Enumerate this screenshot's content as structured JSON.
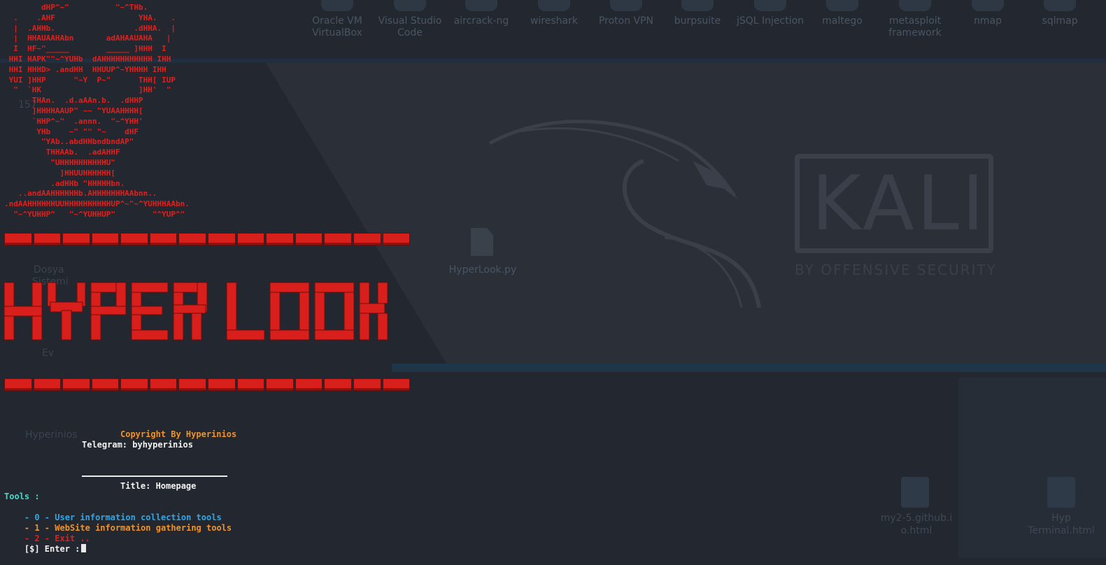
{
  "desktop": {
    "top_icons": [
      {
        "label": "Oracle VM VirtualBox",
        "line1": "Oracle VM",
        "line2": "VirtualBox"
      },
      {
        "label": "Visual Studio Code",
        "line1": "Visual Studio",
        "line2": "Code"
      },
      {
        "label": "aircrack-ng",
        "line1": "aircrack-ng",
        "line2": ""
      },
      {
        "label": "wireshark",
        "line1": "wireshark",
        "line2": ""
      },
      {
        "label": "Proton VPN",
        "line1": "Proton VPN",
        "line2": ""
      },
      {
        "label": "burpsuite",
        "line1": "burpsuite",
        "line2": ""
      },
      {
        "label": "jSQL Injection",
        "line1": "jSQL Injection",
        "line2": ""
      },
      {
        "label": "maltego",
        "line1": "maltego",
        "line2": ""
      },
      {
        "label": "metasploit framework",
        "line1": "metasploit",
        "line2": "framework"
      },
      {
        "label": "nmap",
        "line1": "nmap",
        "line2": ""
      },
      {
        "label": "sqlmap",
        "line1": "sqlmap",
        "line2": ""
      }
    ],
    "file_icon_label": "HyperLook.py",
    "bottom_right_icons": [
      {
        "line1": "my2-5.github.i",
        "line2": "o.html"
      },
      {
        "line1": "Hyp",
        "line2": "Terminal.html"
      }
    ],
    "left_ghost_labels": [
      "157",
      "Dosya",
      "Sistemi",
      "Ev",
      "Hyperinios"
    ],
    "kali_logo": {
      "word": "KALI",
      "subtitle": "BY OFFENSIVE SECURITY"
    }
  },
  "terminal": {
    "credits": {
      "copyright": "Copyright By Hyperinios",
      "telegram": "Telegram: byhyperinios"
    },
    "title": "Title: Homepage",
    "menu_header": "Tools :",
    "menu": [
      {
        "prefix": "- 0 - ",
        "label": "User information collection tools",
        "color": "#31a6e6"
      },
      {
        "prefix": "- 1 - ",
        "label": "WebSite information gathering tools",
        "color": "#f0932b"
      },
      {
        "prefix": "- 2 - ",
        "label": "Exit ..",
        "color": "#e0201d"
      }
    ],
    "prompt": "[$] Enter :"
  },
  "colors": {
    "accent_red": "#e0201d",
    "orange": "#f0932b",
    "teal": "#4ad7c7",
    "blue": "#31a6e6",
    "background": "#23272f"
  }
}
